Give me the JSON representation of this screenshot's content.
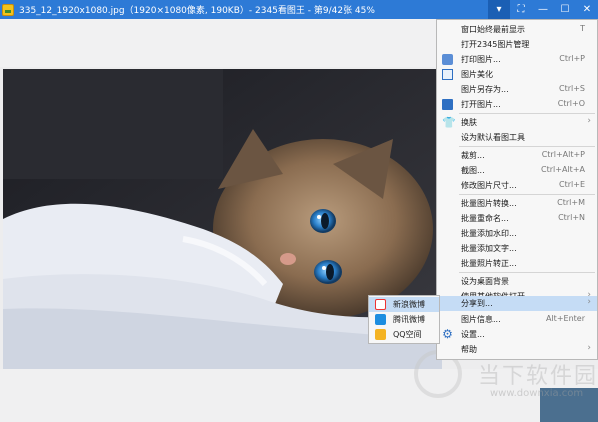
{
  "window": {
    "title": "335_12_1920x1080.jpg（1920×1080像素, 190KB）- 2345看图王 - 第9/42张 45%"
  },
  "titlebar_buttons": [
    {
      "name": "menu-dropdown-button",
      "glyph": "▾",
      "active": true
    },
    {
      "name": "fullscreen-button",
      "glyph": "⛶"
    },
    {
      "name": "minimize-button",
      "glyph": "—"
    },
    {
      "name": "maximize-button",
      "glyph": "☐"
    },
    {
      "name": "close-button",
      "glyph": "✕"
    }
  ],
  "context_menu": {
    "items": [
      {
        "label": "窗口始终最前显示",
        "shortcut": "T",
        "icon": ""
      },
      {
        "label": "打开2345图片管理",
        "shortcut": "",
        "icon": ""
      },
      {
        "label": "打印图片...",
        "shortcut": "Ctrl+P",
        "icon": "printer-icon"
      },
      {
        "label": "图片美化",
        "shortcut": "",
        "icon": "beautify-icon"
      },
      {
        "label": "图片另存为...",
        "shortcut": "Ctrl+S",
        "icon": ""
      },
      {
        "label": "打开图片...",
        "shortcut": "Ctrl+O",
        "icon": "open-folder-icon"
      },
      {
        "label": "换肤",
        "shortcut": "",
        "icon": "skin-icon",
        "submenu": true
      },
      {
        "label": "设为默认看图工具",
        "shortcut": "",
        "icon": ""
      },
      {
        "label": "裁剪...",
        "shortcut": "Ctrl+Alt+P",
        "icon": ""
      },
      {
        "label": "截图...",
        "shortcut": "Ctrl+Alt+A",
        "icon": ""
      },
      {
        "label": "修改图片尺寸...",
        "shortcut": "Ctrl+E",
        "icon": ""
      },
      {
        "label": "批量图片转换...",
        "shortcut": "Ctrl+M",
        "icon": ""
      },
      {
        "label": "批量重命名...",
        "shortcut": "Ctrl+N",
        "icon": ""
      },
      {
        "label": "批量添加水印...",
        "shortcut": "",
        "icon": ""
      },
      {
        "label": "批量添加文字...",
        "shortcut": "",
        "icon": ""
      },
      {
        "label": "批量照片转正...",
        "shortcut": "",
        "icon": ""
      },
      {
        "label": "设为桌面背景",
        "shortcut": "",
        "icon": ""
      },
      {
        "label": "使用其他软件打开",
        "shortcut": "",
        "icon": "",
        "submenu": true
      },
      {
        "label": "分享到...",
        "shortcut": "",
        "icon": "",
        "submenu": true,
        "highlighted": true
      },
      {
        "label": "图片信息...",
        "shortcut": "Alt+Enter",
        "icon": ""
      },
      {
        "label": "设置...",
        "shortcut": "",
        "icon": "gear-icon"
      },
      {
        "label": "帮助",
        "shortcut": "",
        "icon": "",
        "submenu": true
      }
    ]
  },
  "share_submenu": {
    "items": [
      {
        "label": "新浪微博",
        "icon": "sina-weibo-icon",
        "highlighted": true
      },
      {
        "label": "腾讯微博",
        "icon": "tencent-weibo-icon"
      },
      {
        "label": "QQ空间",
        "icon": "qzone-icon"
      }
    ]
  },
  "watermark": {
    "text": "当下软件园",
    "url": "www.downxia.com"
  },
  "colors": {
    "titlebar": "#2d7ad6",
    "highlight": "#c5dcf5",
    "menu_bg": "#f7f7f7"
  }
}
